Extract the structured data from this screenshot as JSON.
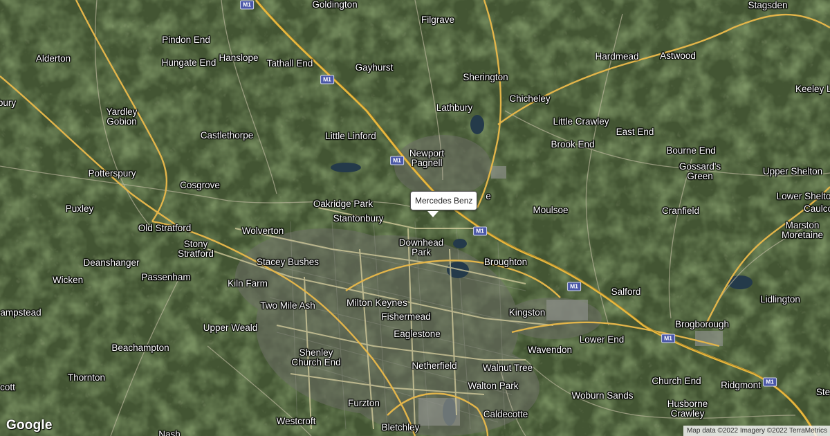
{
  "map": {
    "marker_label": "Mercedes Benz",
    "logo": "Google",
    "attribution": "Map data ©2022 Imagery ©2022 TerraMetrics",
    "motorway_label": "M1",
    "places": [
      "Goldington",
      "Stagsden",
      "Filgrave",
      "Pindon End",
      "Alderton",
      "Hanslope",
      "Hungate End",
      "Tathall End",
      "Gayhurst",
      "Sherington",
      "Hardmead",
      "Astwood",
      "Keeley La",
      "bury",
      "Lathbury",
      "Chicheley",
      "Yardley\nGobion",
      "Little Crawley",
      "East End",
      "Castlethorpe",
      "Little Linford",
      "Brook End",
      "Bourne End",
      "Newport\nPagnell",
      "Gossard's\nGreen",
      "Upper Shelton",
      "Potterspury",
      "Cosgrove",
      "Lower Shelto",
      "Caulco",
      "Puxley",
      "Oakridge Park",
      "Moulsoe",
      "Cranfield",
      "Marston\nMoretaine",
      "Stantonbury",
      "Old Stratford",
      "Wolverton",
      "Stony\nStratford",
      "Downhead\nPark",
      "Deanshanger",
      "Stacey Bushes",
      "Broughton",
      "Wicken",
      "Passenham",
      "Kiln Farm",
      "Salford",
      "Lidlington",
      "Milton Keynes",
      "Two Mile Ash",
      "Kingston",
      "ampstead",
      "Fishermead",
      "Brogborough",
      "Upper Weald",
      "Eaglestone",
      "Lower End",
      "Wavendon",
      "Beachampton",
      "Shenley\nChurch End",
      "Netherfield",
      "Walnut Tree",
      "Church End",
      "Thornton",
      "Ridgmont",
      "Walton Park",
      "cott",
      "Woburn Sands",
      "Furzton",
      "Husborne\nCrawley",
      "Westcroft",
      "Bletchley",
      "Caldecotte",
      "Ste",
      "e",
      "Nash"
    ]
  }
}
